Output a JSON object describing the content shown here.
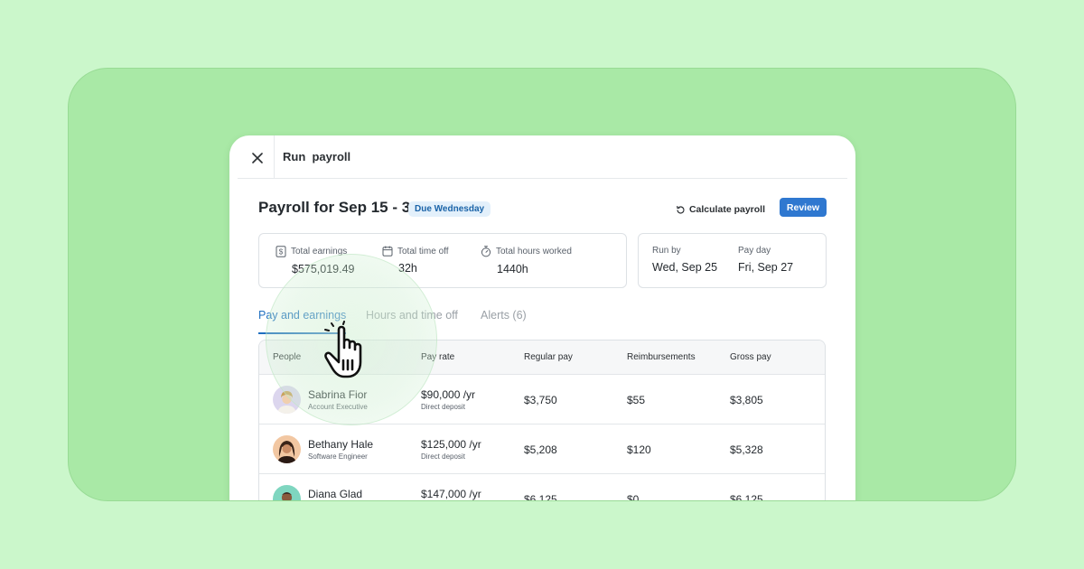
{
  "colors": {
    "page_bg": "#cbf7cb",
    "panel_bg": "#a9e9a6",
    "accent": "#2f78d0",
    "tab_active": "#1f6fc0",
    "badge_bg": "#e3f0fb"
  },
  "topbar": {
    "close_icon": "close-icon",
    "title": "Run  payroll"
  },
  "header": {
    "title": "Payroll for Sep 15 - 30",
    "badge": "Due Wednesday",
    "calculate_label": "Calculate payroll",
    "review_label": "Review"
  },
  "stats": {
    "earnings": {
      "label": "Total earnings",
      "value": "$575,019.49",
      "icon": "dollar-document-icon"
    },
    "time_off": {
      "label": "Total time off",
      "value": "32h",
      "icon": "calendar-icon"
    },
    "hours": {
      "label": "Total hours worked",
      "value": "1440h",
      "icon": "stopwatch-icon"
    }
  },
  "dates": {
    "run_by": {
      "label": "Run by",
      "value": "Wed, Sep 25"
    },
    "pay_day": {
      "label": "Pay day",
      "value": "Fri, Sep 27"
    }
  },
  "tabs": [
    {
      "label": "Pay and earnings",
      "active": true
    },
    {
      "label": "Hours and time off",
      "active": false
    },
    {
      "label": "Alerts (6)",
      "active": false
    }
  ],
  "table": {
    "columns": [
      "People",
      "Pay rate",
      "Regular pay",
      "Reimbursements",
      "Gross pay"
    ],
    "rows": [
      {
        "name": "Sabrina Fior",
        "role": "Account Executive",
        "rate": "$90,000 /yr",
        "rate_sub": "Direct deposit",
        "regular": "$3,750",
        "reimb": "$55",
        "gross": "$3,805"
      },
      {
        "name": "Bethany Hale",
        "role": "Software Engineer",
        "rate": "$125,000 /yr",
        "rate_sub": "Direct deposit",
        "regular": "$5,208",
        "reimb": "$120",
        "gross": "$5,328"
      },
      {
        "name": "Diana Glad",
        "role": "",
        "rate": "$147,000 /yr",
        "rate_sub": "",
        "regular": "$6,125",
        "reimb": "$0",
        "gross": "$6,125"
      }
    ]
  },
  "cursor": "pointer-hand-icon"
}
